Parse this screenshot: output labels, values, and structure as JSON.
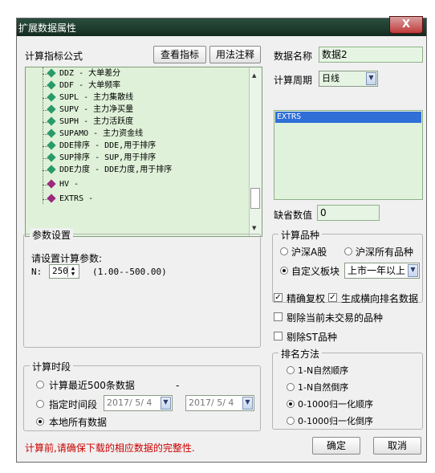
{
  "window": {
    "title": "扩展数据属性",
    "close_label": "X"
  },
  "formula": {
    "label": "计算指标公式",
    "view_button": "查看指标",
    "usage_button": "用法注释",
    "items": [
      "DDZ - 大单差分",
      "DDF - 大单频率",
      "SUPL - 主力集散线",
      "SUPV - 主力净买量",
      "SUPH - 主力活跃度",
      "SUPAMO - 主力资金线",
      "DDE排序 - DDE,用于排序",
      "SUP排序 - SUP,用于排序",
      "DDE力度 - DDE力度,用于排序",
      "HV -",
      "EXTRS -"
    ]
  },
  "data_name": {
    "label": "数据名称",
    "value": "数据2"
  },
  "period": {
    "label": "计算周期",
    "value": "日线"
  },
  "indicator_list": {
    "selected": "EXTRS"
  },
  "missing": {
    "label": "缺省数值",
    "value": "0"
  },
  "params": {
    "group_label": "参数设置",
    "prompt": "请设置计算参数:",
    "n_label": "N:",
    "n_value": "250",
    "range": "(1.00--500.00)"
  },
  "calc_variety": {
    "group_label": "计算品种",
    "opt_a": "沪深A股",
    "opt_all": "沪深所有品种",
    "opt_custom": "自定义板块",
    "custom_value": "上市一年以上"
  },
  "options": {
    "exact_adjust": "精确复权",
    "gen_rank": "生成横向排名数据",
    "exclude_untraded": "剔除当前未交易的品种",
    "exclude_st": "剔除ST品种"
  },
  "rank_method": {
    "group_label": "排名方法",
    "items": [
      "1-N自然顺序",
      "1-N自然倒序",
      "0-1000归一化顺序",
      "0-1000归一化倒序"
    ]
  },
  "period_range": {
    "group_label": "计算时段",
    "opt_recent": "计算最近500条数据",
    "dash": "-",
    "opt_specified": "指定时间段",
    "date_from": "2017/ 5/ 4",
    "date_to": "2017/ 5/ 4",
    "opt_all": "本地所有数据"
  },
  "footer": {
    "warning": "计算前,请确保下载的相应数据的完整性.",
    "ok": "确定",
    "cancel": "取消",
    "warning_color": "#cc0000"
  }
}
